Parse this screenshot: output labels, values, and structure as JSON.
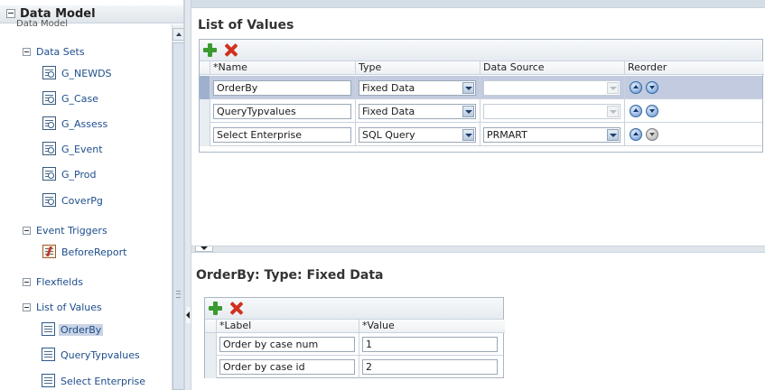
{
  "sidebar": {
    "title": "Data Model",
    "clipped_label": "Data Model",
    "sections": [
      {
        "label": "Data Sets",
        "items": [
          "G_NEWDS",
          "G_Case",
          "G_Assess",
          "G_Event",
          "G_Prod",
          "CoverPg"
        ]
      },
      {
        "label": "Event Triggers",
        "items": [
          "BeforeReport"
        ]
      },
      {
        "label": "Flexfields",
        "items": []
      },
      {
        "label": "List of Values",
        "items": [
          "OrderBy",
          "QueryTypvalues",
          "Select Enterprise"
        ]
      }
    ],
    "selected_item": "OrderBy"
  },
  "lov": {
    "title": "List of Values",
    "columns": [
      "*Name",
      "Type",
      "Data Source",
      "Reorder"
    ],
    "rows": [
      {
        "name": "OrderBy",
        "type": "Fixed Data",
        "data_source": "",
        "selected": true
      },
      {
        "name": "QueryTypvalues",
        "type": "Fixed Data",
        "data_source": "",
        "selected": false
      },
      {
        "name": "Select Enterprise",
        "type": "SQL Query",
        "data_source": "PRMART",
        "selected": false
      }
    ]
  },
  "detail": {
    "title": "OrderBy: Type: Fixed Data",
    "columns": [
      "*Label",
      "*Value"
    ],
    "rows": [
      {
        "label": "Order by case num",
        "value": "1"
      },
      {
        "label": "Order by case id",
        "value": "2"
      }
    ]
  },
  "icons": {
    "add": "add-icon",
    "delete": "delete-icon",
    "move_up": "move-up-icon",
    "move_down": "move-down-icon",
    "collapse": "minus-toggle-icon"
  },
  "colors": {
    "add_green": "#3a9b2e",
    "delete_red": "#d0311f",
    "selected_row": "#c2cbe0",
    "link_blue": "#1d4d8b"
  }
}
